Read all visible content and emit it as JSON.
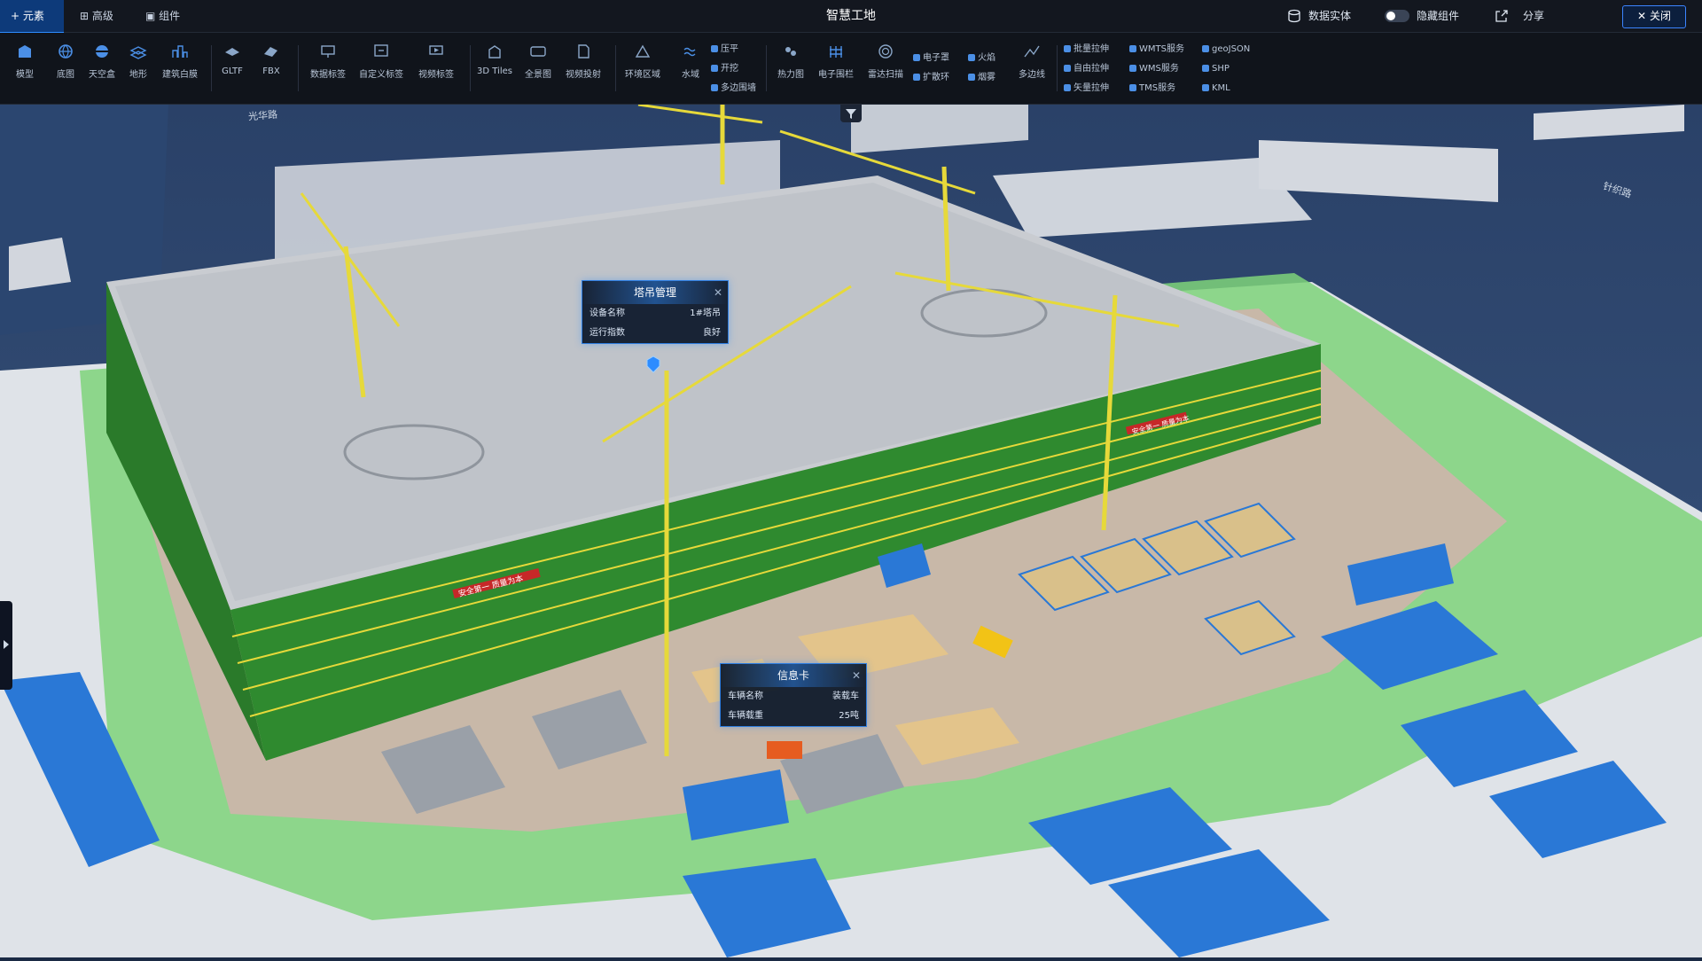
{
  "tabs": [
    {
      "label": "+ 元素",
      "active": true
    },
    {
      "label": "⊞ 高级",
      "active": false
    },
    {
      "label": "▣ 组件",
      "active": false
    }
  ],
  "title": "智慧工地",
  "header_right": {
    "data_entity": "数据实体",
    "hide_components": "隐藏组件",
    "share": "分享",
    "close": "关闭"
  },
  "toolbar": {
    "tools": [
      "模型",
      "底图",
      "天空盒",
      "地形",
      "建筑白膜",
      "GLTF",
      "FBX",
      "数据标签",
      "自定义标签",
      "视频标签",
      "3D Tiles",
      "全景图",
      "视频投射",
      "环境区域",
      "水域",
      "热力图",
      "电子围栏",
      "雷达扫描",
      "多边线"
    ],
    "fx_group": [
      "压平",
      "开挖",
      "多边围墙"
    ],
    "effects_group": [
      "电子罩",
      "扩散环"
    ],
    "fire_group": [
      "火焰",
      "烟雾"
    ],
    "stretch_group": [
      "批量拉伸",
      "自由拉伸",
      "矢量拉伸"
    ],
    "service_group": [
      "WMTS服务",
      "WMS服务",
      "TMS服务"
    ],
    "format_group": [
      "geoJSON",
      "SHP",
      "KML"
    ]
  },
  "scene": {
    "road_labels": [
      "光华路",
      "针织路"
    ],
    "banner_1": "安全第一 质量为本",
    "banner_2": "安全第一 质量为本"
  },
  "popups": {
    "crane": {
      "title": "塔吊管理",
      "rows": [
        {
          "label": "设备名称",
          "value": "1#塔吊"
        },
        {
          "label": "运行指数",
          "value": "良好"
        }
      ]
    },
    "vehicle": {
      "title": "信息卡",
      "rows": [
        {
          "label": "车辆名称",
          "value": "装载车"
        },
        {
          "label": "车辆载重",
          "value": "25吨"
        }
      ]
    }
  },
  "colors": {
    "accent": "#2d8cff",
    "building_green": "#2f8a2f",
    "crane_yellow": "#e6d93a",
    "roof_blue": "#2a78d6"
  }
}
